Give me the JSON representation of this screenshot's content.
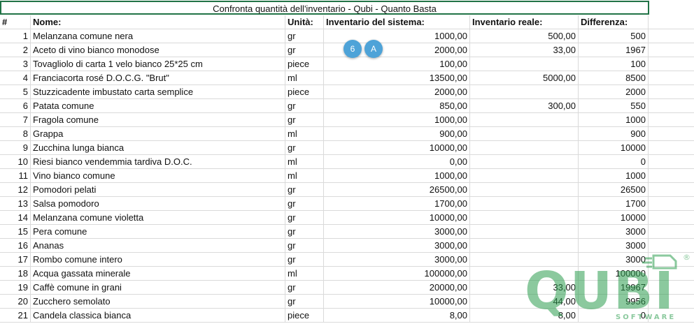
{
  "title": "Confronta quantità dell'inventario - Qubi - Quanto Basta",
  "headers": {
    "num": "#",
    "name": "Nome:",
    "unit": "Unità:",
    "system": "Inventario del sistema:",
    "real": "Inventario reale:",
    "diff": "Differenza:"
  },
  "badges": [
    "6",
    "A"
  ],
  "rows": [
    {
      "n": "1",
      "name": "Melanzana comune nera",
      "unit": "gr",
      "sys": "1000,00",
      "real": "500,00",
      "diff": "500"
    },
    {
      "n": "2",
      "name": "Aceto di vino bianco monodose",
      "unit": "gr",
      "sys": "2000,00",
      "real": "33,00",
      "diff": "1967"
    },
    {
      "n": "3",
      "name": "Tovagliolo di carta 1 velo bianco 25*25 cm",
      "unit": "piece",
      "sys": "100,00",
      "real": "",
      "diff": "100"
    },
    {
      "n": "4",
      "name": "Franciacorta rosé D.O.C.G. \"Brut\"",
      "unit": "ml",
      "sys": "13500,00",
      "real": "5000,00",
      "diff": "8500"
    },
    {
      "n": "5",
      "name": "Stuzzicadente imbustato carta semplice",
      "unit": "piece",
      "sys": "2000,00",
      "real": "",
      "diff": "2000"
    },
    {
      "n": "6",
      "name": "Patata comune",
      "unit": "gr",
      "sys": "850,00",
      "real": "300,00",
      "diff": "550"
    },
    {
      "n": "7",
      "name": "Fragola comune",
      "unit": "gr",
      "sys": "1000,00",
      "real": "",
      "diff": "1000"
    },
    {
      "n": "8",
      "name": "Grappa",
      "unit": "ml",
      "sys": "900,00",
      "real": "",
      "diff": "900"
    },
    {
      "n": "9",
      "name": "Zucchina lunga bianca",
      "unit": "gr",
      "sys": "10000,00",
      "real": "",
      "diff": "10000"
    },
    {
      "n": "10",
      "name": "Riesi bianco vendemmia tardiva D.O.C.",
      "unit": "ml",
      "sys": "0,00",
      "real": "",
      "diff": "0"
    },
    {
      "n": "11",
      "name": "Vino bianco comune",
      "unit": "ml",
      "sys": "1000,00",
      "real": "",
      "diff": "1000"
    },
    {
      "n": "12",
      "name": "Pomodori pelati",
      "unit": "gr",
      "sys": "26500,00",
      "real": "",
      "diff": "26500"
    },
    {
      "n": "13",
      "name": "Salsa pomodoro",
      "unit": "gr",
      "sys": "1700,00",
      "real": "",
      "diff": "1700"
    },
    {
      "n": "14",
      "name": "Melanzana comune violetta",
      "unit": "gr",
      "sys": "10000,00",
      "real": "",
      "diff": "10000"
    },
    {
      "n": "15",
      "name": "Pera comune",
      "unit": "gr",
      "sys": "3000,00",
      "real": "",
      "diff": "3000"
    },
    {
      "n": "16",
      "name": "Ananas",
      "unit": "gr",
      "sys": "3000,00",
      "real": "",
      "diff": "3000"
    },
    {
      "n": "17",
      "name": "Rombo comune intero",
      "unit": "gr",
      "sys": "3000,00",
      "real": "",
      "diff": "3000"
    },
    {
      "n": "18",
      "name": "Acqua gassata minerale",
      "unit": "ml",
      "sys": "100000,00",
      "real": "",
      "diff": "100000"
    },
    {
      "n": "19",
      "name": "Caffè comune in grani",
      "unit": "gr",
      "sys": "20000,00",
      "real": "33,00",
      "diff": "19967"
    },
    {
      "n": "20",
      "name": "Zucchero semolato",
      "unit": "gr",
      "sys": "10000,00",
      "real": "44,00",
      "diff": "9956"
    },
    {
      "n": "21",
      "name": "Candela classica bianca",
      "unit": "piece",
      "sys": "8,00",
      "real": "8,00",
      "diff": "0"
    }
  ],
  "watermark": {
    "brand": "QUBI",
    "tagline": "SOFTWARE",
    "mark": "®",
    "color": "#2e9e4f"
  }
}
